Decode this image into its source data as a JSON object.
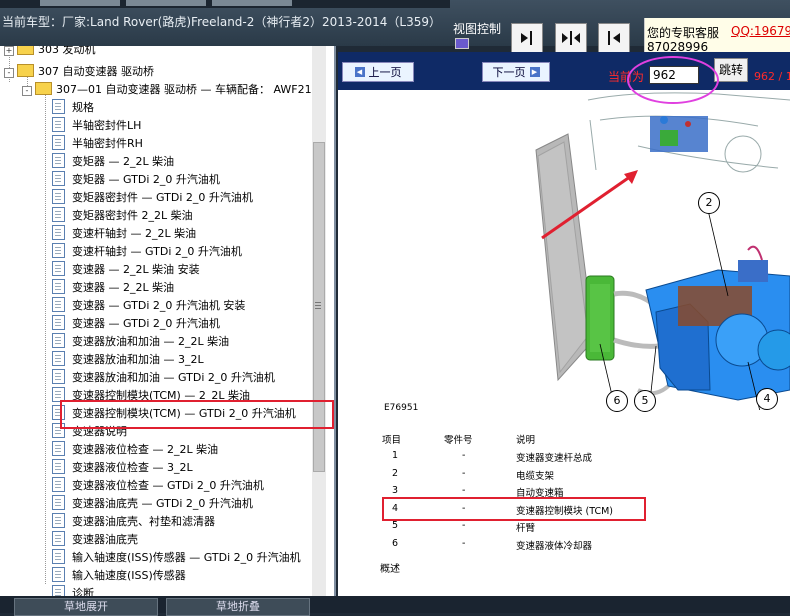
{
  "header": {
    "car_title": "当前车型：厂家:Land Rover(路虎)Freeland-2（神行者2）2013-2014（L359）",
    "view_control_label": "视图控制",
    "view_buttons": [
      "expand-right",
      "expand-both",
      "collapse-left"
    ]
  },
  "service": {
    "label": "您的专职客服",
    "qq": "QQ:19679",
    "phone": "87028996"
  },
  "tree": {
    "root_label": "303 发动机",
    "group_label": "307 自动变速器 驱动桥",
    "subgroup_label": "307—01 自动变速器 驱动桥 — 车辆配备： AWF21",
    "items": [
      "规格",
      "半轴密封件LH",
      "半轴密封件RH",
      "变矩器 — 2_2L 柴油",
      "变矩器 — GTDi 2_0 升汽油机",
      "变矩器密封件 — GTDi 2_0 升汽油机",
      "变矩器密封件 2_2L 柴油",
      "变速杆轴封 — 2_2L 柴油",
      "变速杆轴封 — GTDi 2_0 升汽油机",
      "变速器 — 2_2L 柴油 安装",
      "变速器 — 2_2L 柴油",
      "变速器 — GTDi 2_0 升汽油机 安装",
      "变速器 — GTDi 2_0 升汽油机",
      "变速器放油和加油 — 2_2L 柴油",
      "变速器放油和加油 — 3_2L",
      "变速器放油和加油 — GTDi 2_0 升汽油机",
      "变速器控制模块(TCM) — 2_2L 柴油",
      "变速器控制模块(TCM) — GTDi 2_0 升汽油机",
      "变速器说明",
      "变速器液位检查 — 2_2L 柴油",
      "变速器液位检查 — 3_2L",
      "变速器液位检查 — GTDi 2_0 升汽油机",
      "变速器油底壳 — GTDi 2_0 升汽油机",
      "变速器油底壳、衬垫和滤清器",
      "变速器油底壳",
      "输入轴速度(ISS)传感器 — GTDi 2_0 升汽油机",
      "输入轴速度(ISS)传感器",
      "诊断"
    ]
  },
  "doc": {
    "prev_label": "上一页",
    "next_label": "下一页",
    "current_label": "当前为",
    "page_value": "962",
    "jump_label": "跳转",
    "page_total": "962 / 1",
    "figure_code": "E76951",
    "callouts": [
      "2",
      "6",
      "5",
      "4"
    ],
    "legend_headers": [
      "项目",
      "零件号",
      "说明"
    ],
    "legend_rows": [
      {
        "item": "1",
        "part": "-",
        "desc": "变速器变速杆总成"
      },
      {
        "item": "2",
        "part": "-",
        "desc": "电缆支架"
      },
      {
        "item": "3",
        "part": "-",
        "desc": "自动变速箱"
      },
      {
        "item": "4",
        "part": "-",
        "desc": "变速器控制模块 (TCM)"
      },
      {
        "item": "5",
        "part": "-",
        "desc": "杆臂"
      },
      {
        "item": "6",
        "part": "-",
        "desc": "变速器液体冷却器"
      }
    ],
    "overview": "概述"
  },
  "footer": {
    "left_button": "草地展开",
    "right_button": "草地折叠"
  },
  "colors": {
    "highlight": "#e02030",
    "annotation_magenta": "#e040e0",
    "transmission_blue": "#2a8ef0",
    "cooler_green": "#4ab838"
  }
}
